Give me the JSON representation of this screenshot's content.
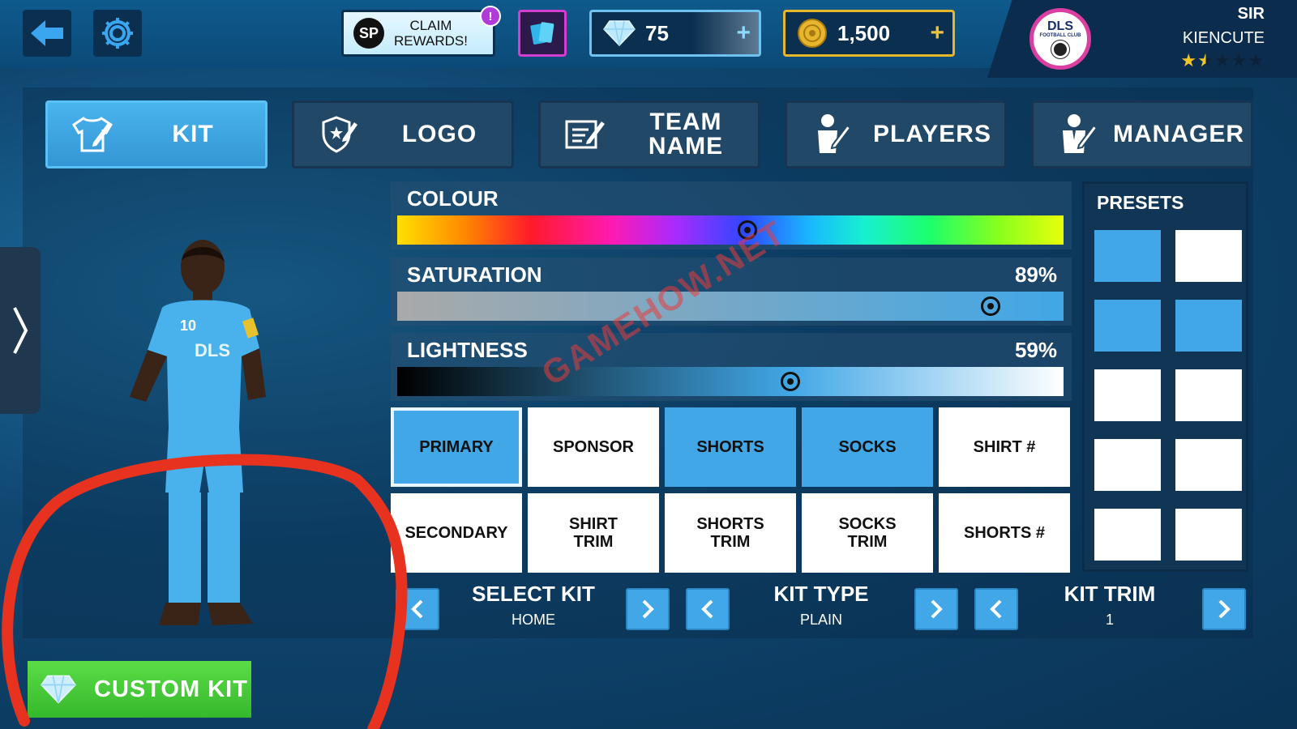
{
  "topbar": {
    "claim_badge": "SP",
    "claim_label_line1": "CLAIM",
    "claim_label_line2": "REWARDS!",
    "claim_alert": "!",
    "gems": "75",
    "coins": "1,500",
    "plus": "+"
  },
  "profile": {
    "club_logo_line1": "DLS",
    "club_logo_line2": "FOOTBALL CLUB",
    "rank": "SIR",
    "name": "KIENCUTE",
    "stars_filled": 1.5,
    "stars_total": 5
  },
  "tabs": [
    {
      "label": "KIT",
      "active": true
    },
    {
      "label": "LOGO",
      "active": false
    },
    {
      "label": "TEAM\nNAME",
      "active": false
    },
    {
      "label": "PLAYERS",
      "active": false
    },
    {
      "label": "MANAGER",
      "active": false
    }
  ],
  "sliders": {
    "colour": {
      "title": "COLOUR",
      "value": 0.525
    },
    "saturation": {
      "title": "SATURATION",
      "percent": "89%",
      "value": 0.89
    },
    "lightness": {
      "title": "LIGHTNESS",
      "percent": "59%",
      "value": 0.59
    }
  },
  "kit_parts": [
    {
      "label": "PRIMARY",
      "state": "selected"
    },
    {
      "label": "SPONSOR",
      "state": "white"
    },
    {
      "label": "SHORTS",
      "state": "blue"
    },
    {
      "label": "SOCKS",
      "state": "blue"
    },
    {
      "label": "SHIRT #",
      "state": "white"
    },
    {
      "label": "SECONDARY",
      "state": "white"
    },
    {
      "label": "SHIRT\nTRIM",
      "state": "white"
    },
    {
      "label": "SHORTS\nTRIM",
      "state": "white"
    },
    {
      "label": "SOCKS\nTRIM",
      "state": "white"
    },
    {
      "label": "SHORTS #",
      "state": "white"
    }
  ],
  "presets": {
    "title": "PRESETS",
    "swatches": [
      "#41a7e6",
      "#ffffff",
      "#41a7e6",
      "#41a7e6",
      "#ffffff",
      "#ffffff",
      "#ffffff",
      "#ffffff",
      "#ffffff",
      "#ffffff"
    ]
  },
  "selectors": {
    "select_kit": {
      "title": "SELECT KIT",
      "value": "HOME"
    },
    "kit_type": {
      "title": "KIT TYPE",
      "value": "PLAIN"
    },
    "kit_trim": {
      "title": "KIT TRIM",
      "value": "1"
    }
  },
  "player": {
    "shirt_number": "10",
    "shirt_text": "DLS"
  },
  "custom_kit_label": "CUSTOM KIT",
  "watermark": "GAMEHOW.NET",
  "colors": {
    "accent_blue": "#41a7e6",
    "green": "#3ec72f",
    "annotation_red": "#e6321e"
  }
}
